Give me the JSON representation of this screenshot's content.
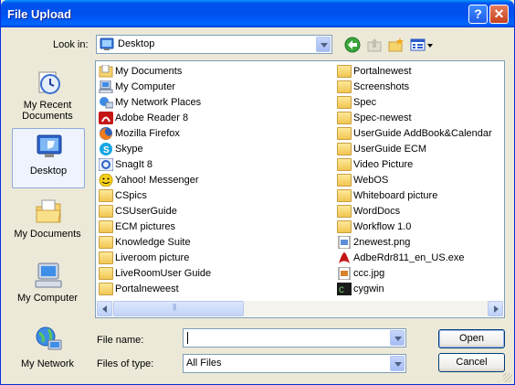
{
  "window": {
    "title": "File Upload",
    "help_glyph": "?",
    "close_glyph": "✕"
  },
  "lookin": {
    "label": "Look in:",
    "value": "Desktop"
  },
  "toolbar_icons": [
    "back-icon",
    "up-folder-icon",
    "new-folder-icon",
    "view-menu-icon"
  ],
  "places": [
    {
      "label": "My Recent Documents",
      "icon": "recent-documents-icon"
    },
    {
      "label": "Desktop",
      "icon": "desktop-icon",
      "selected": true
    },
    {
      "label": "My Documents",
      "icon": "my-documents-icon"
    },
    {
      "label": "My Computer",
      "icon": "my-computer-icon"
    },
    {
      "label": "My Network",
      "icon": "my-network-icon"
    }
  ],
  "files": {
    "col1": [
      {
        "name": "My Documents",
        "icon": "my-documents-icon"
      },
      {
        "name": "My Computer",
        "icon": "my-computer-icon"
      },
      {
        "name": "My Network Places",
        "icon": "network-places-icon"
      },
      {
        "name": "Adobe Reader 8",
        "icon": "adobe-reader-icon"
      },
      {
        "name": "Mozilla Firefox",
        "icon": "firefox-icon"
      },
      {
        "name": "Skype",
        "icon": "skype-icon"
      },
      {
        "name": "SnagIt 8",
        "icon": "snagit-icon"
      },
      {
        "name": "Yahoo! Messenger",
        "icon": "yahoo-messenger-icon"
      },
      {
        "name": "CSpics",
        "icon": "folder-icon"
      },
      {
        "name": "CSUserGuide",
        "icon": "folder-icon"
      },
      {
        "name": "ECM pictures",
        "icon": "folder-icon"
      },
      {
        "name": "Knowledge Suite",
        "icon": "folder-icon"
      },
      {
        "name": "Liveroom picture",
        "icon": "folder-icon"
      },
      {
        "name": "LiveRoomUser Guide",
        "icon": "folder-icon"
      },
      {
        "name": "Portalneweest",
        "icon": "folder-icon"
      }
    ],
    "col2": [
      {
        "name": "Portalnewest",
        "icon": "folder-icon"
      },
      {
        "name": "Screenshots",
        "icon": "folder-icon"
      },
      {
        "name": "Spec",
        "icon": "folder-icon"
      },
      {
        "name": "Spec-newest",
        "icon": "folder-icon"
      },
      {
        "name": "UserGuide AddBook&Calendar",
        "icon": "folder-icon"
      },
      {
        "name": "UserGuide ECM",
        "icon": "folder-icon"
      },
      {
        "name": "Video Picture",
        "icon": "folder-icon"
      },
      {
        "name": "WebOS",
        "icon": "folder-icon"
      },
      {
        "name": "Whiteboard picture",
        "icon": "folder-icon"
      },
      {
        "name": "WordDocs",
        "icon": "folder-icon"
      },
      {
        "name": "Workflow 1.0",
        "icon": "folder-icon"
      },
      {
        "name": "2newest.png",
        "icon": "png-file-icon"
      },
      {
        "name": "AdbeRdr811_en_US.exe",
        "icon": "pdf-installer-icon"
      },
      {
        "name": "ccc.jpg",
        "icon": "jpg-file-icon"
      },
      {
        "name": "cygwin",
        "icon": "cygwin-icon"
      }
    ]
  },
  "filename": {
    "label": "File name:",
    "value": ""
  },
  "filetype": {
    "label": "Files of type:",
    "value": "All Files"
  },
  "buttons": {
    "open": "Open",
    "cancel": "Cancel"
  },
  "colors": {
    "title_blue": "#0053ee",
    "dialog_bg": "#ece9d8",
    "folder_yellow": "#f2c652"
  }
}
